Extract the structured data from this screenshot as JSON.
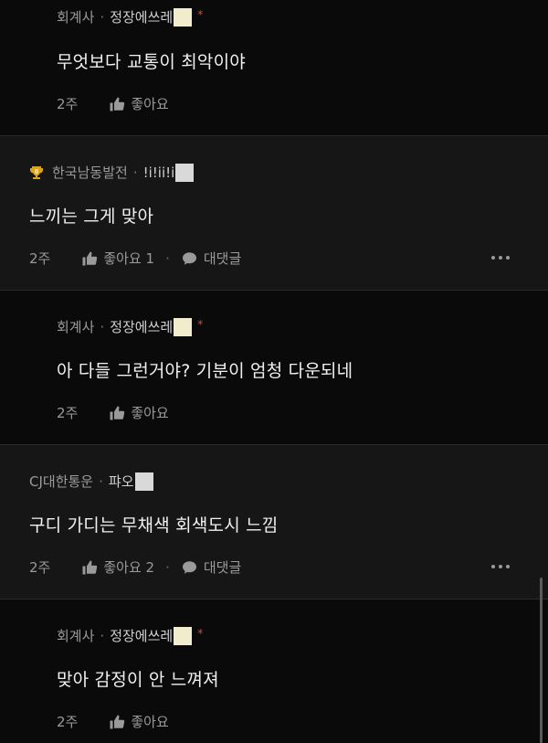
{
  "colors": {
    "background": "#0a0a0a",
    "top_comment_bg": "#161616",
    "star": "#e0443e",
    "mask_cream": "#f1eccb",
    "mask_gray": "#d9d9d9",
    "trophy": "#d9a520"
  },
  "comments": [
    {
      "type": "reply",
      "company": "회계사",
      "nickname": "정장에쓰레",
      "mask": "cream",
      "star": "*",
      "text": "무엇보다 교통이 최악이야",
      "time": "2주",
      "like_label": "좋아요",
      "icon": "thumbs-up-icon"
    },
    {
      "type": "top",
      "company": "한국남동발전",
      "nickname": "!i!ii!i",
      "mask": "gray",
      "badge_icon": "trophy-icon",
      "text": "느끼는 그게 맞아",
      "time": "2주",
      "like_label": "좋아요 1",
      "reply_label": "대댓글",
      "icon": "thumbs-up-icon",
      "reply_icon": "speech-bubble-icon",
      "more_icon": "more-horizontal-icon"
    },
    {
      "type": "reply",
      "company": "회계사",
      "nickname": "정장에쓰레",
      "mask": "cream",
      "star": "*",
      "text": "아 다들 그런거야? 기분이 엄청 다운되네",
      "time": "2주",
      "like_label": "좋아요",
      "icon": "thumbs-up-icon"
    },
    {
      "type": "top",
      "company": "CJ대한통운",
      "nickname": "퍄오",
      "mask": "gray",
      "text": "구디 가디는 무채색 회색도시 느낌",
      "time": "2주",
      "like_label": "좋아요 2",
      "reply_label": "대댓글",
      "icon": "thumbs-up-icon",
      "reply_icon": "speech-bubble-icon",
      "more_icon": "more-horizontal-icon"
    },
    {
      "type": "reply",
      "company": "회계사",
      "nickname": "정장에쓰레",
      "mask": "cream",
      "star": "*",
      "text": "맞아 감정이 안 느껴져",
      "time": "2주",
      "like_label": "좋아요",
      "icon": "thumbs-up-icon"
    }
  ],
  "separator": "·"
}
